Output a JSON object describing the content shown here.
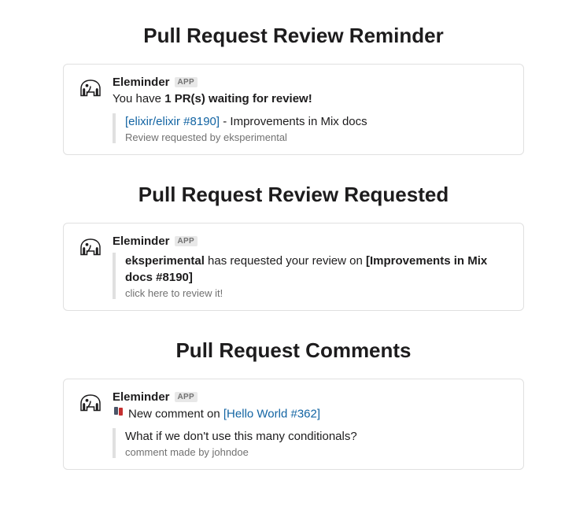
{
  "sections": [
    {
      "title": "Pull Request Review Reminder",
      "app_name": "Eleminder",
      "app_badge": "APP",
      "body_prefix": "You have ",
      "body_bold": "1 PR(s) waiting for review!",
      "attachment": {
        "link_text": "[elixir/elixir #8190]",
        "separator": " - ",
        "rest_text": "Improvements in Mix docs",
        "sub_text": "Review requested by eksperimental"
      }
    },
    {
      "title": "Pull Request Review Requested",
      "app_name": "Eleminder",
      "app_badge": "APP",
      "attachment": {
        "bold_user": "eksperimental",
        "middle_text": " has requested your review on ",
        "bold_pr": "[Improvements in Mix docs #8190]",
        "sub_text": "click here to review it!"
      }
    },
    {
      "title": "Pull Request Comments",
      "app_name": "Eleminder",
      "app_badge": "APP",
      "body_prefix": "New comment on ",
      "body_link": "[Hello World #362]",
      "attachment": {
        "comment_text": "What if we don't use this many conditionals?",
        "sub_text": "comment made by johndoe"
      }
    }
  ]
}
